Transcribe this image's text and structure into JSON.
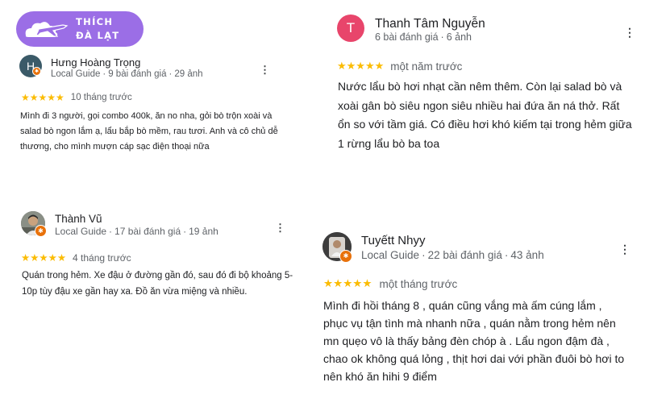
{
  "brand": {
    "line1": "THÍCH",
    "line2": "ĐÀ LẠT",
    "color": "#9b6ee6"
  },
  "colors": {
    "star": "#fbbc04",
    "local_guide_badge": "#e8710a",
    "meta_text": "#5f6368"
  },
  "icons": {
    "more": "more-vert-icon",
    "star": "star-icon",
    "badge": "local-guide-badge-icon"
  },
  "reviews": [
    {
      "avatar_letter": "H",
      "avatar_color": "#3b5a68",
      "name": "Hưng Hoàng Trọng",
      "role": "Local Guide",
      "review_count": "9 bài đánh giá",
      "photo_count": "29 ảnh",
      "stars": "★★★★★",
      "rating": 5,
      "time": "10 tháng trước",
      "text": "Mình đi 3 người, gọi combo 400k, ăn no nha, gỏi bò trộn xoài và salad bò ngon lắm ạ, lẩu bắp bò mềm, rau tươi. Anh và cô chủ dễ thương, cho mình mượn cáp sạc điện thoại nữa"
    },
    {
      "avatar_letter": "T",
      "avatar_color": "#e8456b",
      "name": "Thanh Tâm Nguyễn",
      "review_count": "6 bài đánh giá",
      "photo_count": "6 ảnh",
      "stars": "★★★★★",
      "rating": 5,
      "time": "một năm trước",
      "text": "Nước lẩu bò hơi nhạt cần nêm thêm. Còn lại salad bò và xoài gân bò siêu ngon siêu nhiều hai đứa ăn ná thở. Rất ổn so với tầm giá. Có điều hơi khó kiếm tại trong hẻm giữa 1 rừng lẩu bò ba toa"
    },
    {
      "name": "Thành Vũ",
      "role": "Local Guide",
      "review_count": "17 bài đánh giá",
      "photo_count": "19 ảnh",
      "stars": "★★★★★",
      "rating": 5,
      "time": "4 tháng trước",
      "text": "Quán trong hẻm. Xe đậu ở đường gần đó, sau đó đi bộ khoảng 5-10p tùy đậu xe gần hay xa. Đồ ăn vừa miệng và nhiều."
    },
    {
      "name": "Tuyếtt Nhyy",
      "role": "Local Guide",
      "review_count": "22 bài đánh giá",
      "photo_count": "43 ảnh",
      "stars": "★★★★★",
      "rating": 5,
      "time": "một tháng trước",
      "text": "Mình đi hồi tháng 8 , quán cũng vắng mà ấm cúng lắm , phục vụ tận tình mà nhanh nữa , quán nằm trong hẻm nên mn quẹo vô là thấy bảng đèn chóp à . Lẩu ngon đậm đà , chao ok không quá lỏng , thịt hơi dai với phần đuôi bò hơi to nên khó ăn hihi 9 điểm"
    }
  ]
}
